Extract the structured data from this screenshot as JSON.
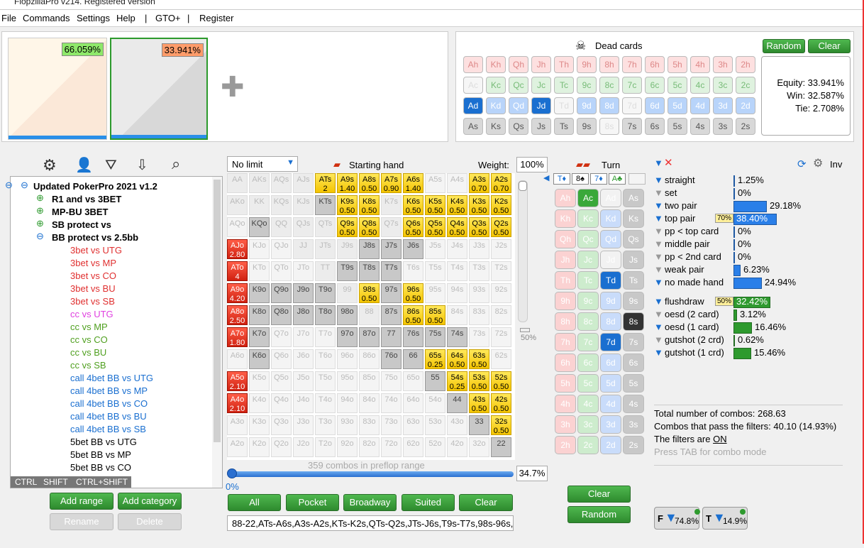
{
  "app": {
    "title": "FlopzillaPro v214. Registered version"
  },
  "menu": [
    "File",
    "Commands",
    "Settings",
    "Help",
    "|",
    "GTO+",
    "|",
    "Register"
  ],
  "thumbs": [
    {
      "pct": "66.059%"
    },
    {
      "pct": "33.941%"
    }
  ],
  "dead": {
    "title": "Dead cards",
    "random": "Random",
    "clear": "Clear",
    "rows": [
      [
        "Ah",
        "Kh",
        "Qh",
        "Jh",
        "Th",
        "9h",
        "8h",
        "7h",
        "6h",
        "5h",
        "4h",
        "3h",
        "2h"
      ],
      [
        "Ac",
        "Kc",
        "Qc",
        "Jc",
        "Tc",
        "9c",
        "8c",
        "7c",
        "6c",
        "5c",
        "4c",
        "3c",
        "2c"
      ],
      [
        "Ad",
        "Kd",
        "Qd",
        "Jd",
        "Td",
        "9d",
        "8d",
        "7d",
        "6d",
        "5d",
        "4d",
        "3d",
        "2d"
      ],
      [
        "As",
        "Ks",
        "Qs",
        "Js",
        "Ts",
        "9s",
        "8s",
        "7s",
        "6s",
        "5s",
        "4s",
        "3s",
        "2s"
      ]
    ]
  },
  "equity": {
    "equity": "Equity: 33.941%",
    "win": "Win: 32.587%",
    "tie": "Tie: 2.708%"
  },
  "tree": {
    "root": "Updated PokerPro 2021 v1.2",
    "groups": [
      "R1 and vs 3BET",
      "MP-BU 3BET",
      "SB protect vs",
      "BB protect vs 2.5bb"
    ],
    "items": [
      {
        "t": "3bet vs UTG",
        "c": "#e03030"
      },
      {
        "t": "3bet vs MP",
        "c": "#e03030"
      },
      {
        "t": "3bet vs CO",
        "c": "#e03030"
      },
      {
        "t": "3bet vs BU",
        "c": "#e03030"
      },
      {
        "t": "3bet vs SB",
        "c": "#e03030"
      },
      {
        "t": "cc vs UTG",
        "c": "#e040e0"
      },
      {
        "t": "cc vs MP",
        "c": "#50a020"
      },
      {
        "t": "cc vs CO",
        "c": "#50a020"
      },
      {
        "t": "cc vs BU",
        "c": "#50a020"
      },
      {
        "t": "cc vs SB",
        "c": "#50a020"
      },
      {
        "t": "call 4bet BB vs UTG",
        "c": "#1a6fd0"
      },
      {
        "t": "call 4bet BB vs MP",
        "c": "#1a6fd0"
      },
      {
        "t": "call 4bet BB vs CO",
        "c": "#1a6fd0"
      },
      {
        "t": "call 4bet BB vs BU",
        "c": "#1a6fd0"
      },
      {
        "t": "call 4bet BB vs SB",
        "c": "#1a6fd0"
      },
      {
        "t": "5bet BB vs UTG",
        "c": "#000"
      },
      {
        "t": "5bet BB vs MP",
        "c": "#000"
      },
      {
        "t": "5bet BB vs CO",
        "c": "#000"
      }
    ],
    "keys": [
      "CTRL",
      "SHIFT",
      "CTRL+SHIFT"
    ],
    "buttons": [
      "Add range",
      "Add category",
      "Rename",
      "Delete"
    ]
  },
  "grid": {
    "limit": "No limit",
    "starting": "Starting hand",
    "weight_label": "Weight:",
    "weight": "100%",
    "pct_right": "50%",
    "combos": "359 combos in preflop range",
    "slider_pct": "34.7%",
    "slider_zero": "0%",
    "rows": [
      [
        "AA",
        "AKs",
        "AQs",
        "AJs",
        "ATs",
        "A9s",
        "A8s",
        "A7s",
        "A6s",
        "A5s",
        "A4s",
        "A3s",
        "A2s"
      ],
      [
        "AKo",
        "KK",
        "KQs",
        "KJs",
        "KTs",
        "K9s",
        "K8s",
        "K7s",
        "K6s",
        "K5s",
        "K4s",
        "K3s",
        "K2s"
      ],
      [
        "AQo",
        "KQo",
        "QQ",
        "QJs",
        "QTs",
        "Q9s",
        "Q8s",
        "Q7s",
        "Q6s",
        "Q5s",
        "Q4s",
        "Q3s",
        "Q2s"
      ],
      [
        "AJo",
        "KJo",
        "QJo",
        "JJ",
        "JTs",
        "J9s",
        "J8s",
        "J7s",
        "J6s",
        "J5s",
        "J4s",
        "J3s",
        "J2s"
      ],
      [
        "ATo",
        "KTo",
        "QTo",
        "JTo",
        "TT",
        "T9s",
        "T8s",
        "T7s",
        "T6s",
        "T5s",
        "T4s",
        "T3s",
        "T2s"
      ],
      [
        "A9o",
        "K9o",
        "Q9o",
        "J9o",
        "T9o",
        "99",
        "98s",
        "97s",
        "96s",
        "95s",
        "94s",
        "93s",
        "92s"
      ],
      [
        "A8o",
        "K8o",
        "Q8o",
        "J8o",
        "T8o",
        "98o",
        "88",
        "87s",
        "86s",
        "85s",
        "84s",
        "83s",
        "82s"
      ],
      [
        "A7o",
        "K7o",
        "Q7o",
        "J7o",
        "T7o",
        "97o",
        "87o",
        "77",
        "76s",
        "75s",
        "74s",
        "73s",
        "72s"
      ],
      [
        "A6o",
        "K6o",
        "Q6o",
        "J6o",
        "T6o",
        "96o",
        "86o",
        "76o",
        "66",
        "65s",
        "64s",
        "63s",
        "62s"
      ],
      [
        "A5o",
        "K5o",
        "Q5o",
        "J5o",
        "T5o",
        "95o",
        "85o",
        "75o",
        "65o",
        "55",
        "54s",
        "53s",
        "52s"
      ],
      [
        "A4o",
        "K4o",
        "Q4o",
        "J4o",
        "T4o",
        "94o",
        "84o",
        "74o",
        "64o",
        "54o",
        "44",
        "43s",
        "42s"
      ],
      [
        "A3o",
        "K3o",
        "Q3o",
        "J3o",
        "T3o",
        "93o",
        "83o",
        "73o",
        "63o",
        "53o",
        "43o",
        "33",
        "32s"
      ],
      [
        "A2o",
        "K2o",
        "Q2o",
        "J2o",
        "T2o",
        "92o",
        "82o",
        "72o",
        "62o",
        "52o",
        "42o",
        "32o",
        "22"
      ]
    ],
    "weights": {
      "ATs": "2",
      "A9s": "1.40",
      "A8s": "0.50",
      "A7s": "0.90",
      "A6s": "1.40",
      "A3s": "0.70",
      "A2s": "0.70",
      "K9s": "0.50",
      "K8s": "0.50",
      "K6s": "0.50",
      "K5s": "0.50",
      "K4s": "0.50",
      "K3s": "0.50",
      "K2s": "0.50",
      "Q9s": "0.50",
      "Q8s": "0.50",
      "Q6s": "0.50",
      "Q5s": "0.50",
      "Q4s": "0.50",
      "Q3s": "0.50",
      "Q2s": "0.50",
      "AJo": "2.80",
      "ATo": "4",
      "A9o": "4.20",
      "A8o": "2.50",
      "A7o": "1.80",
      "98s": "0.50",
      "96s": "0.50",
      "86s": "0.50",
      "85s": "0.50",
      "65s": "0.25",
      "64s": "0.50",
      "63s": "0.50",
      "54s": "0.25",
      "53s": "0.50",
      "52s": "0.50",
      "43s": "0.50",
      "42s": "0.50",
      "32s": "0.50",
      "A5o": "2.10",
      "A4o": "2.10"
    },
    "buttons": [
      "All",
      "Pocket",
      "Broadway",
      "Suited",
      "Clear"
    ],
    "range_text": "88-22,ATs-A6s,A3s-A2s,KTs-K2s,QTs-Q2s,JTs-J6s,T9s-T7s,98s-96s,8"
  },
  "turn": {
    "title": "Turn",
    "board": [
      "T♦",
      "8♠",
      "7♦",
      "A♣"
    ],
    "cols": [
      [
        "Ah",
        "Kh",
        "Qh",
        "Jh",
        "Th",
        "9h",
        "8h",
        "7h",
        "6h",
        "5h",
        "4h",
        "3h",
        "2h"
      ],
      [
        "Ac",
        "Kc",
        "Qc",
        "Jc",
        "Tc",
        "9c",
        "8c",
        "7c",
        "6c",
        "5c",
        "4c",
        "3c",
        "2c"
      ],
      [
        "Ad",
        "Kd",
        "Qd",
        "Jd",
        "Td",
        "9d",
        "8d",
        "7d",
        "6d",
        "5d",
        "4d",
        "3d",
        "2d"
      ],
      [
        "As",
        "Ks",
        "Qs",
        "Js",
        "Ts",
        "9s",
        "8s",
        "7s",
        "6s",
        "5s",
        "4s",
        "3s",
        "2s"
      ]
    ],
    "clear": "Clear",
    "random": "Random"
  },
  "stats": {
    "inv": "Inv",
    "made": [
      {
        "l": "straight",
        "v": "1.25%",
        "f": 0.0125
      },
      {
        "l": "set",
        "v": "0%",
        "f": 0
      },
      {
        "l": "two pair",
        "v": "29.18%",
        "f": 0.2918
      },
      {
        "l": "top pair",
        "v": "38.40%",
        "f": 0.384,
        "tag": "70%"
      },
      {
        "l": "pp < top card",
        "v": "0%",
        "f": 0
      },
      {
        "l": "middle pair",
        "v": "0%",
        "f": 0
      },
      {
        "l": "pp < 2nd card",
        "v": "0%",
        "f": 0
      },
      {
        "l": "weak pair",
        "v": "6.23%",
        "f": 0.0623
      },
      {
        "l": "no made hand",
        "v": "24.94%",
        "f": 0.2494
      }
    ],
    "draws": [
      {
        "l": "flushdraw",
        "v": "32.42%",
        "f": 0.3242,
        "tag": "50%"
      },
      {
        "l": "oesd (2 card)",
        "v": "3.12%",
        "f": 0.0312
      },
      {
        "l": "oesd (1 card)",
        "v": "16.46%",
        "f": 0.1646
      },
      {
        "l": "gutshot (2 crd)",
        "v": "0.62%",
        "f": 0.0062
      },
      {
        "l": "gutshot (1 crd)",
        "v": "15.46%",
        "f": 0.1546
      }
    ],
    "total": "Total number of combos: 268.63",
    "pass": "Combos that pass the filters: 40.10 (14.93%)",
    "on": "The filters are ",
    "on_v": "ON",
    "tab": "Press TAB for combo mode",
    "b1": "74.8%",
    "b2": "14.9%"
  }
}
